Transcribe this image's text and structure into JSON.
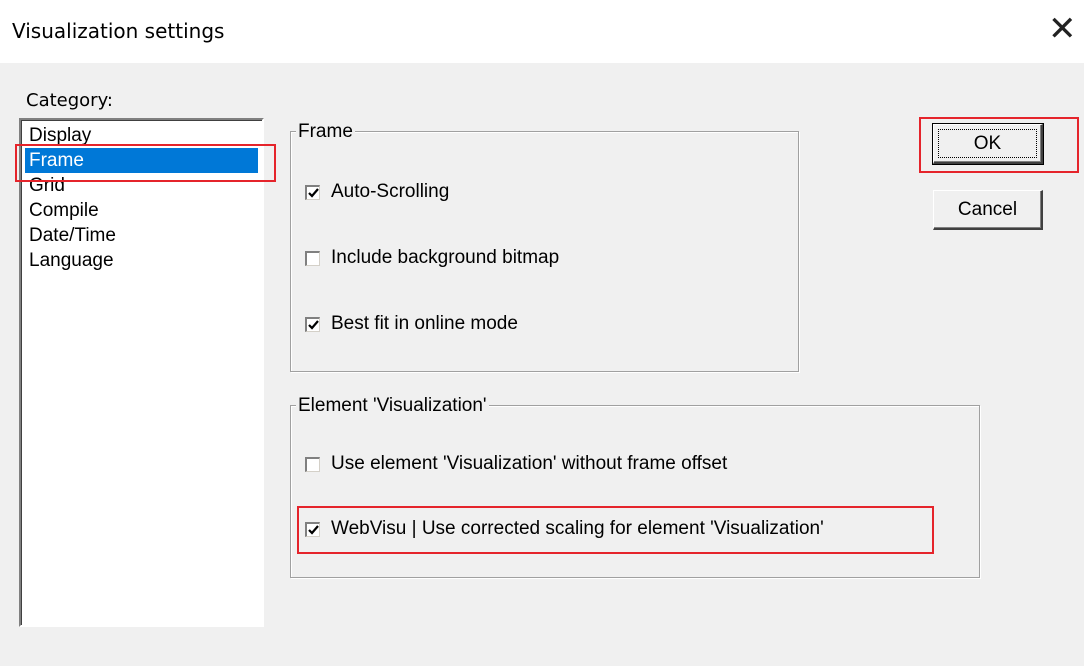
{
  "window": {
    "title": "Visualization settings",
    "close_glyph": "✕"
  },
  "category": {
    "label": "Category:",
    "items": [
      {
        "label": "Display",
        "selected": false
      },
      {
        "label": "Frame",
        "selected": true
      },
      {
        "label": "Grid",
        "selected": false
      },
      {
        "label": "Compile",
        "selected": false
      },
      {
        "label": "Date/Time",
        "selected": false
      },
      {
        "label": "Language",
        "selected": false
      }
    ]
  },
  "frame_group": {
    "legend": "Frame",
    "options": [
      {
        "label": "Auto-Scrolling",
        "checked": true
      },
      {
        "label": "Include background bitmap",
        "checked": false
      },
      {
        "label": "Best fit in online mode",
        "checked": true
      }
    ]
  },
  "element_group": {
    "legend": "Element 'Visualization'",
    "options": [
      {
        "label": "Use element 'Visualization' without frame offset",
        "checked": false
      },
      {
        "label": "WebVisu | Use corrected scaling for element 'Visualization'",
        "checked": true
      }
    ]
  },
  "buttons": {
    "ok": "OK",
    "cancel": "Cancel"
  },
  "colors": {
    "selection": "#0078d7",
    "highlight": "#e5242b",
    "dialog_bg": "#f0f0f0"
  }
}
